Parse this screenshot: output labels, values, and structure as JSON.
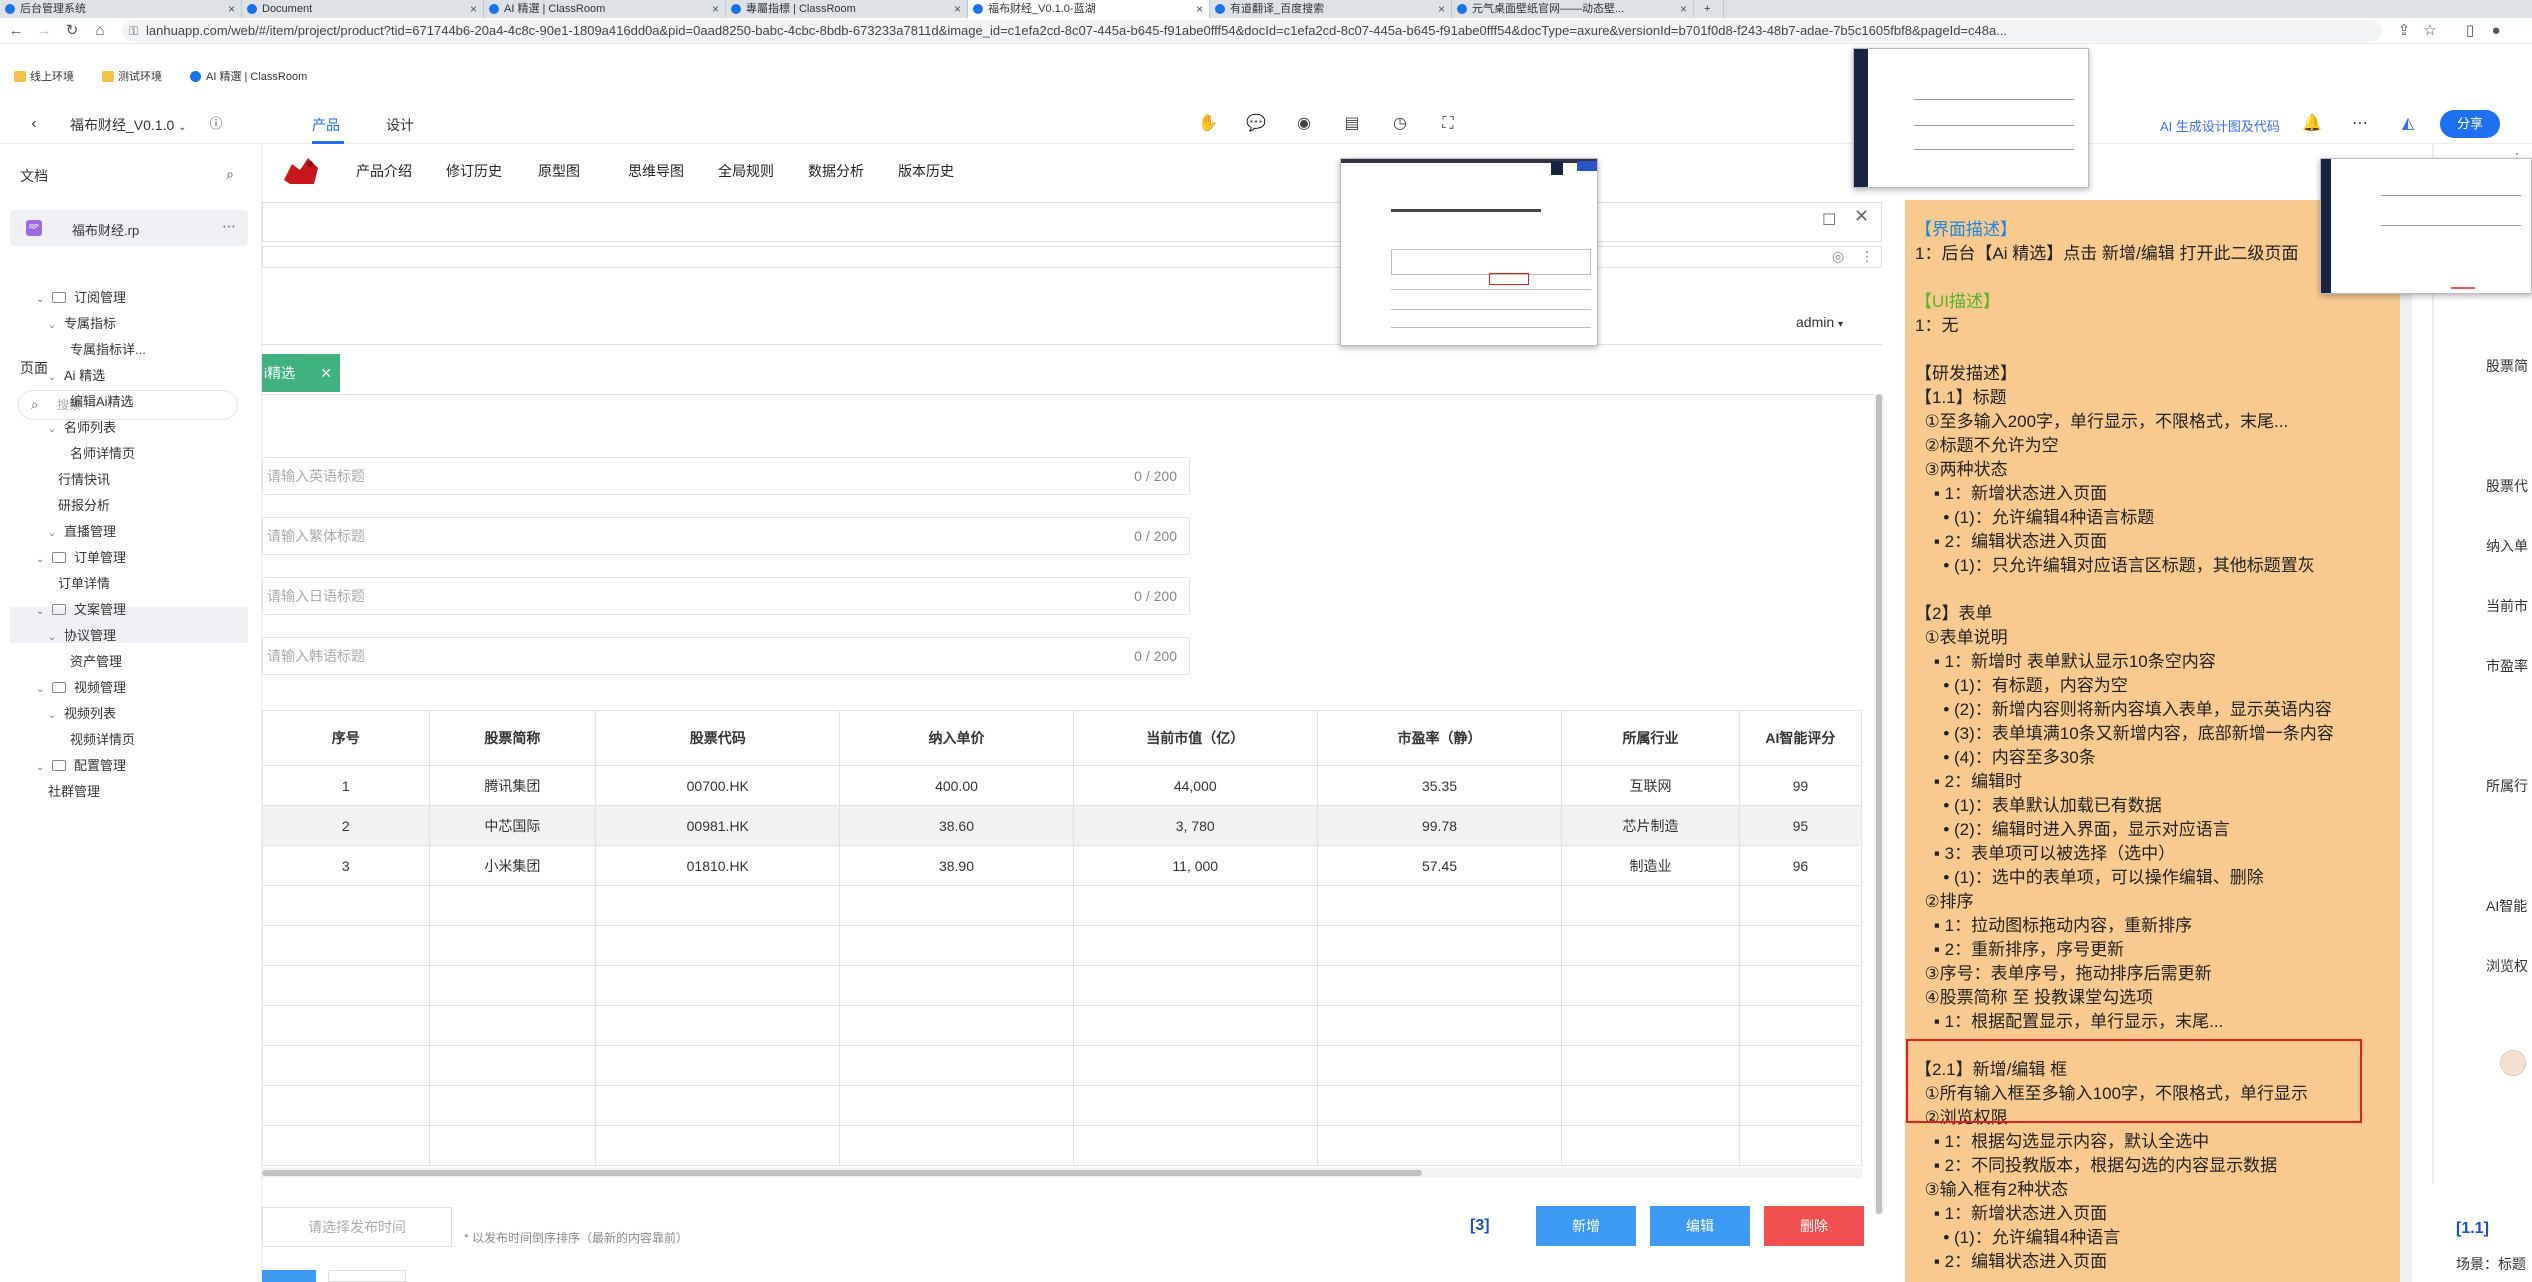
{
  "browser": {
    "tabs": [
      {
        "title": "后台管理系统",
        "active": false
      },
      {
        "title": "Document",
        "active": false
      },
      {
        "title": "AI 精選 | ClassRoom",
        "active": false
      },
      {
        "title": "專屬指標 | ClassRoom",
        "active": false
      },
      {
        "title": "福布财经_V0.1.0-蓝湖",
        "active": true
      },
      {
        "title": "有道翻译_百度搜索",
        "active": false
      },
      {
        "title": "元气桌面壁纸官网——动态壁...",
        "active": false
      }
    ],
    "url": "lanhuapp.com/web/#/item/project/product?tid=671744b6-20a4-4c8c-90e1-1809a416dd0a&pid=0aad8250-babc-4cbc-8bdb-673233a7811d&image_id=c1efa2cd-8c07-445a-b645-f91abe0fff54&docId=c1efa2cd-8c07-445a-b645-f91abe0fff54&docType=axure&versionId=b701f0d8-f243-48b7-adae-7b5c1605fbf8&pageId=c48a...",
    "bookmarks": [
      "线上环境",
      "测试环境",
      "AI 精選 | ClassRoom"
    ]
  },
  "viewer": {
    "project_name": "福布财经_V0.1.0",
    "tab_product": "产品",
    "tab_design": "设计",
    "ai_link": "AI 生成设计图及代码",
    "share": "分享"
  },
  "sidebar": {
    "docs_heading": "文档",
    "doc_file": "福布财经.rp",
    "doc_badge": "RP",
    "pages_heading": "页面",
    "search_placeholder": "搜索",
    "tree": [
      {
        "label": "订阅管理",
        "level": 0,
        "folder": true
      },
      {
        "label": "专属指标",
        "level": 1,
        "folder": false
      },
      {
        "label": "专属指标详...",
        "level": 2,
        "folder": false
      },
      {
        "label": "Ai 精选",
        "level": 1,
        "folder": false
      },
      {
        "label": "编辑Ai精选",
        "level": 2,
        "folder": false,
        "active": true
      },
      {
        "label": "名师列表",
        "level": 1,
        "folder": false
      },
      {
        "label": "名师详情页",
        "level": 2,
        "folder": false
      },
      {
        "label": "行情快讯",
        "level": 1,
        "folder": false
      },
      {
        "label": "研报分析",
        "level": 1,
        "folder": false
      },
      {
        "label": "直播管理",
        "level": 1,
        "folder": false
      },
      {
        "label": "订单管理",
        "level": 0,
        "folder": true
      },
      {
        "label": "订单详情",
        "level": 1,
        "folder": false
      },
      {
        "label": "文案管理",
        "level": 0,
        "folder": true
      },
      {
        "label": "协议管理",
        "level": 1,
        "folder": false
      },
      {
        "label": "资产管理",
        "level": 2,
        "folder": false
      },
      {
        "label": "视频管理",
        "level": 0,
        "folder": true
      },
      {
        "label": "视频列表",
        "level": 1,
        "folder": false
      },
      {
        "label": "视频详情页",
        "level": 2,
        "folder": false
      },
      {
        "label": "配置管理",
        "level": 0,
        "folder": true
      },
      {
        "label": "社群管理",
        "level": 1,
        "folder": false
      }
    ]
  },
  "prototype": {
    "nav": [
      "产品介绍",
      "修订历史",
      "原型图",
      "思维导图",
      "全局规则",
      "数据分析",
      "版本历史"
    ],
    "user": "admin",
    "tag_chip": "i精选",
    "title_inputs": [
      {
        "placeholder": "请输入英语标题",
        "count": "0 / 200"
      },
      {
        "placeholder": "请输入繁体标题",
        "count": "0 / 200"
      },
      {
        "placeholder": "请输入日语标题",
        "count": "0 / 200"
      },
      {
        "placeholder": "请输入韩语标题",
        "count": "0 / 200"
      }
    ],
    "table": {
      "headers": [
        "序号",
        "股票简称",
        "股票代码",
        "纳入单价",
        "当前市值（亿）",
        "市盈率（静）",
        "所属行业",
        "AI智能评分"
      ],
      "rows": [
        [
          "1",
          "腾讯集团",
          "00700.HK",
          "400.00",
          "44,000",
          "35.35",
          "互联网",
          "99"
        ],
        [
          "2",
          "中芯国际",
          "00981.HK",
          "38.60",
          "3, 780",
          "99.78",
          "芯片制造",
          "95"
        ],
        [
          "3",
          "小米集团",
          "01810.HK",
          "38.90",
          "11, 000",
          "57.45",
          "制造业",
          "96"
        ]
      ]
    },
    "time_placeholder": "请选择发布时间",
    "time_hint": "* 以发布时间倒序排序（最新的内容靠前）",
    "page_count": "[3]",
    "btn_add": "新增",
    "btn_edit": "编辑",
    "btn_delete": "删除"
  },
  "notes": {
    "lines": [
      {
        "text": "【界面描述】",
        "color": "blue"
      },
      {
        "text": "1：后台【Ai 精选】点击 新增/编辑 打开此二级页面",
        "color": "default"
      },
      {
        "text": "",
        "color": "default"
      },
      {
        "text": "【UI描述】",
        "color": "green"
      },
      {
        "text": "1：无",
        "color": "default"
      },
      {
        "text": "",
        "color": "default"
      },
      {
        "text": "【研发描述】",
        "color": "default"
      },
      {
        "text": "【1.1】标题",
        "color": "default"
      },
      {
        "text": "  ①至多输入200字，单行显示，不限格式，末尾...",
        "color": "default"
      },
      {
        "text": "  ②标题不允许为空",
        "color": "default"
      },
      {
        "text": "  ③两种状态",
        "color": "default"
      },
      {
        "text": "    ▪ 1：新增状态进入页面",
        "color": "default"
      },
      {
        "text": "      • (1)：允许编辑4种语言标题",
        "color": "default"
      },
      {
        "text": "    ▪ 2：编辑状态进入页面",
        "color": "default"
      },
      {
        "text": "      • (1)：只允许编辑对应语言区标题，其他标题置灰",
        "color": "default"
      },
      {
        "text": "",
        "color": "default"
      },
      {
        "text": "【2】表单",
        "color": "default"
      },
      {
        "text": "  ①表单说明",
        "color": "default"
      },
      {
        "text": "    ▪ 1：新增时 表单默认显示10条空内容",
        "color": "default"
      },
      {
        "text": "      • (1)：有标题，内容为空",
        "color": "default"
      },
      {
        "text": "      • (2)：新增内容则将新内容填入表单，显示英语内容",
        "color": "default"
      },
      {
        "text": "      • (3)：表单填满10条又新增内容，底部新增一条内容",
        "color": "default"
      },
      {
        "text": "      • (4)：内容至多30条",
        "color": "default"
      },
      {
        "text": "    ▪ 2：编辑时",
        "color": "default"
      },
      {
        "text": "      • (1)：表单默认加载已有数据",
        "color": "default"
      },
      {
        "text": "      • (2)：编辑时进入界面，显示对应语言",
        "color": "default"
      },
      {
        "text": "    ▪ 3：表单项可以被选择（选中）",
        "color": "default"
      },
      {
        "text": "      • (1)：选中的表单项，可以操作编辑、删除",
        "color": "default"
      },
      {
        "text": "  ②排序",
        "color": "default"
      },
      {
        "text": "    ▪ 1：拉动图标拖动内容，重新排序",
        "color": "default"
      },
      {
        "text": "    ▪ 2：重新排序，序号更新",
        "color": "default"
      },
      {
        "text": "  ③序号：表单序号，拖动排序后需更新",
        "color": "default"
      },
      {
        "text": "  ④股票简称 至 投教课堂勾选项",
        "color": "default"
      },
      {
        "text": "    ▪ 1：根据配置显示，单行显示，末尾...",
        "color": "default"
      },
      {
        "text": "",
        "color": "default"
      },
      {
        "text": "【2.1】新增/编辑 框",
        "color": "default"
      },
      {
        "text": "  ①所有输入框至多输入100字，不限格式，单行显示",
        "color": "default"
      },
      {
        "text": "  ②浏览权限",
        "color": "default"
      },
      {
        "text": "    ▪ 1：根据勾选显示内容，默认全选中",
        "color": "default"
      },
      {
        "text": "    ▪ 2：不同投教版本，根据勾选的内容显示数据",
        "color": "default"
      },
      {
        "text": "  ③输入框有2种状态",
        "color": "default"
      },
      {
        "text": "    ▪ 1：新增状态进入页面",
        "color": "default"
      },
      {
        "text": "      • (1)：允许编辑4种语言",
        "color": "default"
      },
      {
        "text": "    ▪ 2：编辑状态进入页面",
        "color": "default"
      }
    ]
  },
  "right_partial": {
    "labels": [
      "股票简",
      "股票代",
      "纳入单",
      "当前市",
      "市盈率",
      "所属行",
      "AI智能",
      "浏览权"
    ],
    "section": "[1.1]",
    "footer": "场景：标题"
  },
  "colors": {
    "accent": "#1f6ff2",
    "notes_bg": "#f8ca8f",
    "tag_green": "#3fb27f",
    "delete_red": "#f05050",
    "action_blue": "#3c9af2"
  }
}
